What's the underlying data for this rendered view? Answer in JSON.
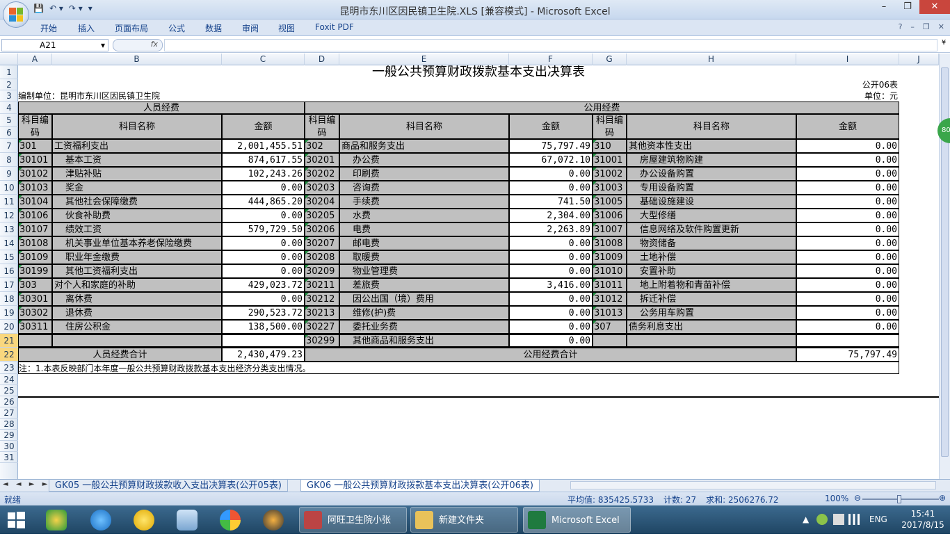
{
  "window": {
    "title": "昆明市东川区因民镇卫生院.XLS  [兼容模式] - Microsoft Excel",
    "min": "–",
    "restore": "❐",
    "close": "✕"
  },
  "qat": {
    "save": "💾",
    "undo": "↶ ▾",
    "redo": "↷ ▾",
    "customize": "▾"
  },
  "ribbon": {
    "tabs": [
      "开始",
      "插入",
      "页面布局",
      "公式",
      "数据",
      "审阅",
      "视图",
      "Foxit PDF"
    ],
    "help": "?",
    "min": "–",
    "restore": "❐",
    "close": "✕"
  },
  "formula": {
    "namebox": "A21",
    "fx": "fx",
    "dropdown": "▾",
    "expand": "¥"
  },
  "columns": [
    "A",
    "B",
    "C",
    "D",
    "E",
    "F",
    "G",
    "H",
    "I",
    "J"
  ],
  "rows": [
    "1",
    "2",
    "3",
    "4",
    "5",
    "6",
    "7",
    "8",
    "9",
    "10",
    "11",
    "12",
    "13",
    "14",
    "15",
    "16",
    "17",
    "18",
    "19",
    "20",
    "21",
    "22",
    "23",
    "24",
    "25",
    "26",
    "27",
    "28",
    "29",
    "30",
    "31"
  ],
  "sheet": {
    "title": "一般公共预算财政拨款基本支出决算表",
    "form_no": "公开06表",
    "org": "编制单位：昆明市东川区因民镇卫生院",
    "unit": "单位：元",
    "personnel_header": "人员经费",
    "public_header": "公用经费",
    "code_hdr": "科目编码",
    "name_hdr": "科目名称",
    "amount_hdr": "金额",
    "personnel_rows": [
      {
        "code": "301",
        "name": "工资福利支出",
        "amount": "2,001,455.51",
        "indent": false
      },
      {
        "code": "30101",
        "name": "基本工资",
        "amount": "874,617.55",
        "indent": true
      },
      {
        "code": "30102",
        "name": "津贴补贴",
        "amount": "102,243.26",
        "indent": true
      },
      {
        "code": "30103",
        "name": "奖金",
        "amount": "0.00",
        "indent": true
      },
      {
        "code": "30104",
        "name": "其他社会保障缴费",
        "amount": "444,865.20",
        "indent": true
      },
      {
        "code": "30106",
        "name": "伙食补助费",
        "amount": "0.00",
        "indent": true
      },
      {
        "code": "30107",
        "name": "绩效工资",
        "amount": "579,729.50",
        "indent": true
      },
      {
        "code": "30108",
        "name": "机关事业单位基本养老保险缴费",
        "amount": "0.00",
        "indent": true
      },
      {
        "code": "30109",
        "name": "职业年金缴费",
        "amount": "0.00",
        "indent": true
      },
      {
        "code": "30199",
        "name": "其他工资福利支出",
        "amount": "0.00",
        "indent": true
      },
      {
        "code": "303",
        "name": "对个人和家庭的补助",
        "amount": "429,023.72",
        "indent": false
      },
      {
        "code": "30301",
        "name": "离休费",
        "amount": "0.00",
        "indent": true
      },
      {
        "code": "30302",
        "name": "退休费",
        "amount": "290,523.72",
        "indent": true
      },
      {
        "code": "30311",
        "name": "住房公积金",
        "amount": "138,500.00",
        "indent": true
      }
    ],
    "public_rows1": [
      {
        "code": "302",
        "name": "商品和服务支出",
        "amount": "75,797.49",
        "indent": false
      },
      {
        "code": "30201",
        "name": "办公费",
        "amount": "67,072.10",
        "indent": true
      },
      {
        "code": "30202",
        "name": "印刷费",
        "amount": "0.00",
        "indent": true
      },
      {
        "code": "30203",
        "name": "咨询费",
        "amount": "0.00",
        "indent": true
      },
      {
        "code": "30204",
        "name": "手续费",
        "amount": "741.50",
        "indent": true
      },
      {
        "code": "30205",
        "name": "水费",
        "amount": "2,304.00",
        "indent": true
      },
      {
        "code": "30206",
        "name": "电费",
        "amount": "2,263.89",
        "indent": true
      },
      {
        "code": "30207",
        "name": "邮电费",
        "amount": "0.00",
        "indent": true
      },
      {
        "code": "30208",
        "name": "取暖费",
        "amount": "0.00",
        "indent": true
      },
      {
        "code": "30209",
        "name": "物业管理费",
        "amount": "0.00",
        "indent": true
      },
      {
        "code": "30211",
        "name": "差旅费",
        "amount": "3,416.00",
        "indent": true
      },
      {
        "code": "30212",
        "name": "因公出国（境）费用",
        "amount": "0.00",
        "indent": true
      },
      {
        "code": "30213",
        "name": "维修(护)费",
        "amount": "0.00",
        "indent": true
      },
      {
        "code": "30227",
        "name": "委托业务费",
        "amount": "0.00",
        "indent": true
      },
      {
        "code": "30299",
        "name": "其他商品和服务支出",
        "amount": "0.00",
        "indent": true
      }
    ],
    "public_rows2": [
      {
        "code": "310",
        "name": "其他资本性支出",
        "amount": "0.00",
        "indent": false
      },
      {
        "code": "31001",
        "name": "房屋建筑物购建",
        "amount": "0.00",
        "indent": true
      },
      {
        "code": "31002",
        "name": "办公设备购置",
        "amount": "0.00",
        "indent": true
      },
      {
        "code": "31003",
        "name": "专用设备购置",
        "amount": "0.00",
        "indent": true
      },
      {
        "code": "31005",
        "name": "基础设施建设",
        "amount": "0.00",
        "indent": true
      },
      {
        "code": "31006",
        "name": "大型修缮",
        "amount": "0.00",
        "indent": true
      },
      {
        "code": "31007",
        "name": "信息网络及软件购置更新",
        "amount": "0.00",
        "indent": true
      },
      {
        "code": "31008",
        "name": "物资储备",
        "amount": "0.00",
        "indent": true
      },
      {
        "code": "31009",
        "name": "土地补偿",
        "amount": "0.00",
        "indent": true
      },
      {
        "code": "31010",
        "name": "安置补助",
        "amount": "0.00",
        "indent": true
      },
      {
        "code": "31011",
        "name": "地上附着物和青苗补偿",
        "amount": "0.00",
        "indent": true
      },
      {
        "code": "31012",
        "name": "拆迁补偿",
        "amount": "0.00",
        "indent": true
      },
      {
        "code": "31013",
        "name": "公务用车购置",
        "amount": "0.00",
        "indent": true
      },
      {
        "code": "307",
        "name": "债务利息支出",
        "amount": "0.00",
        "indent": false
      }
    ],
    "personnel_total_label": "人员经费合计",
    "personnel_total": "2,430,479.23",
    "public_total_label": "公用经费合计",
    "public_total": "75,797.49",
    "note": "注：1.本表反映部门本年度一般公共预算财政拨款基本支出经济分类支出情况。"
  },
  "tabs": {
    "nav": "◄ ◄ ► ►",
    "tab1": "GK05 一般公共预算财政拨款收入支出决算表(公开05表)",
    "tab2": "GK06 一般公共预算财政拨款基本支出决算表(公开06表)"
  },
  "status": {
    "ready": "就绪",
    "avg": "平均值: 835425.5733",
    "count": "计数: 27",
    "sum": "求和: 2506276.72",
    "zoom": "100%",
    "zoom_minus": "⊖",
    "zoom_plus": "⊕"
  },
  "taskbar": {
    "task1": "阿旺卫生院小张",
    "task2": "新建文件夹",
    "task3": "Microsoft Excel ...",
    "lang": "ENG",
    "time": "15:41",
    "date": "2017/8/15",
    "tray_arrow": "▲"
  },
  "side_badge": "80"
}
